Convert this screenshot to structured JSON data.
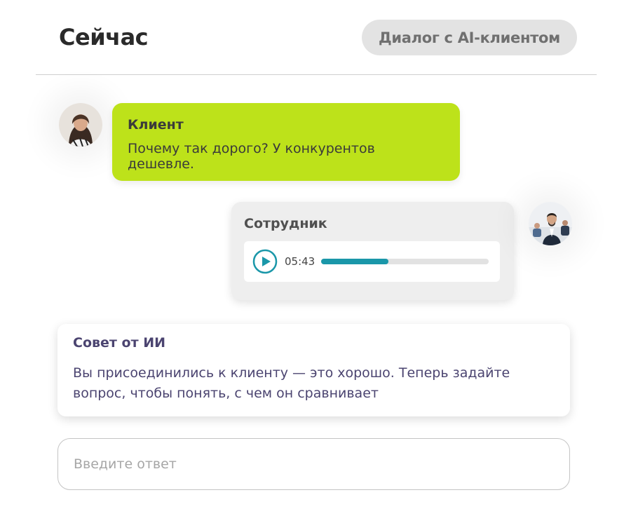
{
  "header": {
    "title": "Сейчас",
    "mode_label": "Диалог с AI-клиентом"
  },
  "messages": [
    {
      "role": "client",
      "author": "Клиент",
      "text": "Почему так дорого? У конкурентов дешевле.",
      "color": "#bde21a"
    },
    {
      "role": "employee",
      "author": "Сотрудник",
      "audio": {
        "duration": "05:43",
        "progress": 0.4,
        "accent": "#1a97a9"
      },
      "color": "#eeeeee"
    }
  ],
  "ai_tip": {
    "title": "Совет от ИИ",
    "text": "Вы присоединились к клиенту — это хорошо. Теперь задайте вопрос, чтобы понять, с чем он сравнивает"
  },
  "answer_input": {
    "placeholder": "Введите ответ",
    "value": ""
  },
  "icons": {
    "play": "play-circle-icon"
  }
}
